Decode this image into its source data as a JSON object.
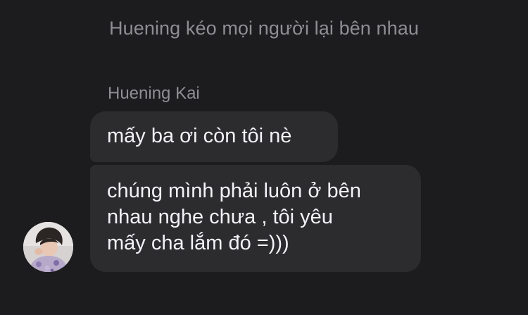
{
  "conversation": {
    "system_notice": "Huening kéo mọi người lại bên nhau",
    "sender_name": "Huening Kai",
    "messages": [
      {
        "lines": [
          "mấy ba ơi còn tôi nè"
        ]
      },
      {
        "lines": [
          "chúng mình phải luôn ở bên",
          "nhau nghe chưa , tôi yêu",
          "mấy cha lắm đó =)))"
        ]
      }
    ],
    "avatar_icon": "user-avatar-photo"
  },
  "colors": {
    "background": "#1c1c1e",
    "bubble": "#2c2c2e",
    "secondary_text": "#8e8e93",
    "primary_text": "#f2f2f7"
  }
}
